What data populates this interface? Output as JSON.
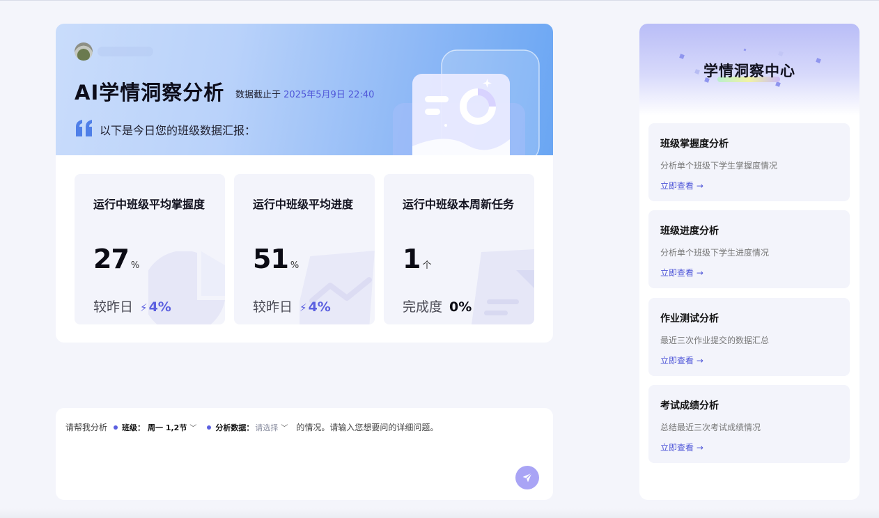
{
  "hero": {
    "title": "AI学情洞察分析",
    "date_prefix": "数据截止于",
    "date_value": "2025年5月9日 22:40",
    "subtitle": "以下是今日您的班级数据汇报："
  },
  "stats": [
    {
      "title": "运行中班级平均掌握度",
      "value": "27",
      "unit": "%",
      "compare_label": "较昨日",
      "delta": "4%"
    },
    {
      "title": "运行中班级平均进度",
      "value": "51",
      "unit": "%",
      "compare_label": "较昨日",
      "delta": "4%"
    },
    {
      "title": "运行中班级本周新任务",
      "value": "1",
      "unit": "个",
      "compare_label": "完成度",
      "delta": "0%"
    }
  ],
  "chat": {
    "prefix": "请帮我分析",
    "class_label": "班级：",
    "class_value": "周一 1,2节",
    "data_label": "分析数据：",
    "data_placeholder": "请选择",
    "suffix": "的情况。请输入您想要问的详细问题。"
  },
  "side": {
    "title": "学情洞察中心",
    "items": [
      {
        "title": "班级掌握度分析",
        "desc": "分析单个班级下学生掌握度情况",
        "link": "立即查看 →"
      },
      {
        "title": "班级进度分析",
        "desc": "分析单个班级下学生进度情况",
        "link": "立即查看 →"
      },
      {
        "title": "作业测试分析",
        "desc": "最近三次作业提交的数据汇总",
        "link": "立即查看 →"
      },
      {
        "title": "考试成绩分析",
        "desc": "总结最近三次考试成绩情况",
        "link": "立即查看 →"
      }
    ]
  },
  "colors": {
    "accent": "#5b5fe0",
    "link": "#4f56d8",
    "send_button": "#a9a4f5"
  },
  "icons": {
    "quote": "quote-icon",
    "send": "send-icon",
    "chevron": "chevron-down-icon",
    "trend": "bolt-trend-icon"
  }
}
